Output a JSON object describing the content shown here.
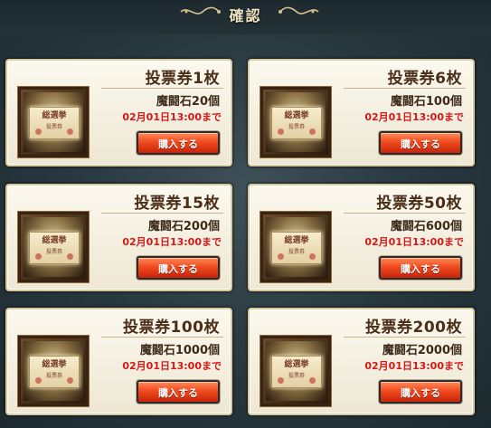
{
  "header": {
    "title": "確認"
  },
  "items": [
    {
      "title": "投票券1枚",
      "price": "魔闘石20個",
      "deadline": "02月01日13:00まで",
      "button": "購入する",
      "ticket_text": "総選挙",
      "ticket_sub": "投票券"
    },
    {
      "title": "投票券6枚",
      "price": "魔闘石100個",
      "deadline": "02月01日13:00まで",
      "button": "購入する",
      "ticket_text": "総選挙",
      "ticket_sub": "投票券"
    },
    {
      "title": "投票券15枚",
      "price": "魔闘石200個",
      "deadline": "02月01日13:00まで",
      "button": "購入する",
      "ticket_text": "総選挙",
      "ticket_sub": "投票券"
    },
    {
      "title": "投票券50枚",
      "price": "魔闘石600個",
      "deadline": "02月01日13:00まで",
      "button": "購入する",
      "ticket_text": "総選挙",
      "ticket_sub": "投票券"
    },
    {
      "title": "投票券100枚",
      "price": "魔闘石1000個",
      "deadline": "02月01日13:00まで",
      "button": "購入する",
      "ticket_text": "総選挙",
      "ticket_sub": "投票券"
    },
    {
      "title": "投票券200枚",
      "price": "魔闘石2000個",
      "deadline": "02月01日13:00まで",
      "button": "購入する",
      "ticket_text": "総選挙",
      "ticket_sub": "投票券"
    }
  ],
  "colors": {
    "accent_button": "#f04b1e",
    "deadline_text": "#d31818",
    "card_border": "#d9c89a"
  }
}
